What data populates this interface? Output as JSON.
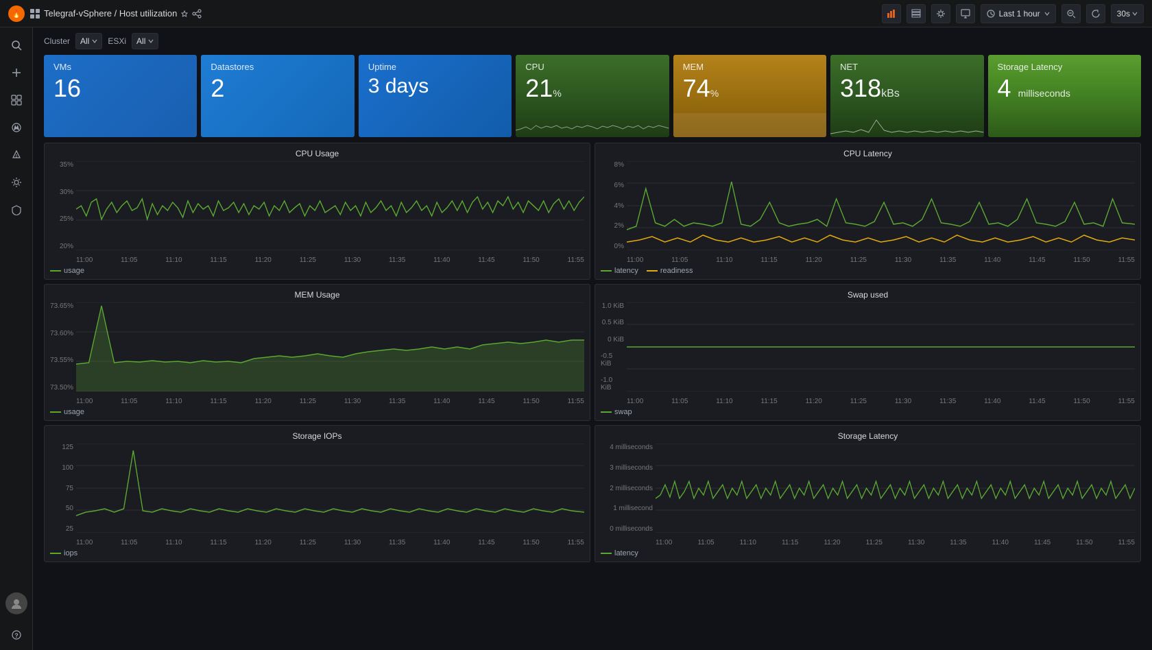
{
  "app": {
    "logo": "🔥",
    "title": "Telegraf-vSphere / Host utilization",
    "starred": false
  },
  "toolbar": {
    "graph_icon": "📊",
    "table_icon": "⊞",
    "settings_icon": "⚙",
    "monitor_icon": "🖥",
    "time_label": "Last 1 hour",
    "zoom_out_icon": "🔍",
    "refresh_icon": "↺",
    "interval": "30s"
  },
  "filters": {
    "cluster_label": "Cluster",
    "cluster_value": "All",
    "esxi_label": "ESXi",
    "esxi_value": "All"
  },
  "stat_cards": [
    {
      "id": "vms",
      "title": "VMs",
      "value": "16",
      "unit": "",
      "color": "blue"
    },
    {
      "id": "datastores",
      "title": "Datastores",
      "value": "2",
      "unit": "",
      "color": "blue2"
    },
    {
      "id": "uptime",
      "title": "Uptime",
      "value": "3 days",
      "unit": "",
      "color": "blue3"
    },
    {
      "id": "cpu",
      "title": "CPU",
      "value": "21",
      "unit": "%",
      "color": "cpu"
    },
    {
      "id": "mem",
      "title": "MEM",
      "value": "74",
      "unit": "%",
      "color": "mem"
    },
    {
      "id": "net",
      "title": "NET",
      "value": "318",
      "unit": "kBs",
      "color": "net"
    },
    {
      "id": "storage_latency",
      "title": "Storage Latency",
      "value": "4",
      "unit": "milliseconds",
      "color": "storage"
    }
  ],
  "charts": {
    "cpu_usage": {
      "title": "CPU Usage",
      "y_axis": [
        "35%",
        "30%",
        "25%",
        "20%"
      ],
      "x_axis": [
        "11:00",
        "11:05",
        "11:10",
        "11:15",
        "11:20",
        "11:25",
        "11:30",
        "11:35",
        "11:40",
        "11:45",
        "11:50",
        "11:55"
      ],
      "legend": [
        {
          "label": "usage",
          "color": "green"
        }
      ]
    },
    "cpu_latency": {
      "title": "CPU Latency",
      "y_axis": [
        "8%",
        "6%",
        "4%",
        "2%",
        "0%"
      ],
      "x_axis": [
        "11:00",
        "11:05",
        "11:10",
        "11:15",
        "11:20",
        "11:25",
        "11:30",
        "11:35",
        "11:40",
        "11:45",
        "11:50",
        "11:55"
      ],
      "legend": [
        {
          "label": "latency",
          "color": "green"
        },
        {
          "label": "readiness",
          "color": "yellow"
        }
      ]
    },
    "mem_usage": {
      "title": "MEM Usage",
      "y_axis": [
        "73.65%",
        "73.60%",
        "73.55%",
        "73.50%"
      ],
      "x_axis": [
        "11:00",
        "11:05",
        "11:10",
        "11:15",
        "11:20",
        "11:25",
        "11:30",
        "11:35",
        "11:40",
        "11:45",
        "11:50",
        "11:55"
      ],
      "legend": [
        {
          "label": "usage",
          "color": "green"
        }
      ]
    },
    "swap_used": {
      "title": "Swap used",
      "y_axis": [
        "1.0 KiB",
        "0.5 KiB",
        "0 KiB",
        "-0.5 KiB",
        "-1.0 KiB"
      ],
      "x_axis": [
        "11:00",
        "11:05",
        "11:10",
        "11:15",
        "11:20",
        "11:25",
        "11:30",
        "11:35",
        "11:40",
        "11:45",
        "11:50",
        "11:55"
      ],
      "legend": [
        {
          "label": "swap",
          "color": "green"
        }
      ]
    },
    "storage_iops": {
      "title": "Storage IOPs",
      "y_axis": [
        "125",
        "100",
        "75",
        "50",
        "25"
      ],
      "x_axis": [
        "11:00",
        "11:05",
        "11:10",
        "11:15",
        "11:20",
        "11:25",
        "11:30",
        "11:35",
        "11:40",
        "11:45",
        "11:50",
        "11:55"
      ],
      "legend": [
        {
          "label": "iops",
          "color": "green"
        }
      ]
    },
    "storage_latency": {
      "title": "Storage Latency",
      "y_axis": [
        "4 milliseconds",
        "3 milliseconds",
        "2 milliseconds",
        "1 millisecond",
        "0 milliseconds"
      ],
      "x_axis": [
        "11:00",
        "11:05",
        "11:10",
        "11:15",
        "11:20",
        "11:25",
        "11:30",
        "11:35",
        "11:40",
        "11:45",
        "11:50",
        "11:55"
      ],
      "legend": [
        {
          "label": "latency",
          "color": "green"
        }
      ]
    }
  }
}
